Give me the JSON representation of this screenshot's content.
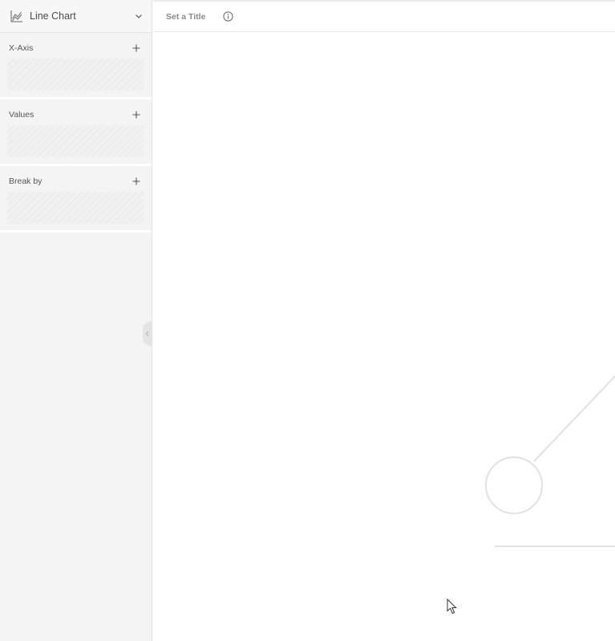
{
  "sidebar": {
    "chart_type": {
      "label": "Line Chart",
      "icon": "line-chart-icon"
    },
    "panels": [
      {
        "title": "X-Axis",
        "add_icon": "plus-icon"
      },
      {
        "title": "Values",
        "add_icon": "plus-icon"
      },
      {
        "title": "Break by",
        "add_icon": "plus-icon"
      }
    ],
    "collapse_icon": "chevron-left-icon"
  },
  "header": {
    "title_placeholder": "Set a Title",
    "info_icon": "info-icon"
  },
  "colors": {
    "sidebar_bg": "#f4f4f4",
    "placeholder_stroke": "#e0e0e0",
    "text_muted": "#8a8a8a"
  }
}
